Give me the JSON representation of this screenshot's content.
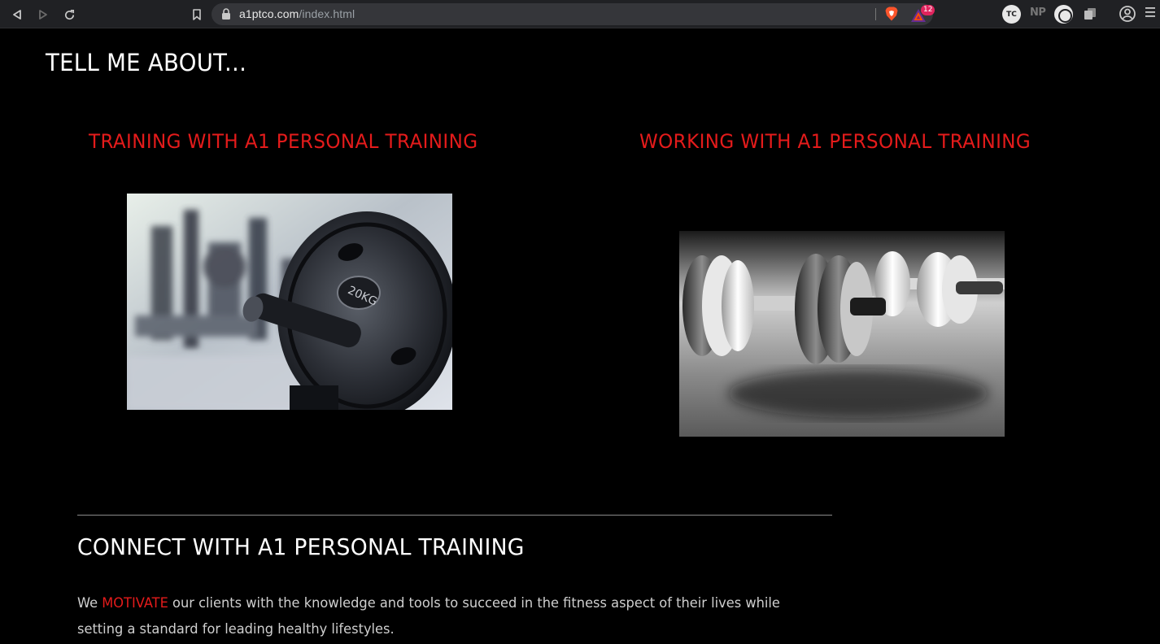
{
  "browser": {
    "url_host": "a1ptco.com",
    "url_path": "/index.html",
    "badge_count": "12",
    "ext_tc_label": "TC",
    "ext_np_label": "NP",
    "icons": [
      "back-icon",
      "forward-icon",
      "reload-icon",
      "bookmark-icon",
      "lock-icon",
      "brave-shield-icon",
      "brave-rewards-icon",
      "profile-icon",
      "menu-icon"
    ]
  },
  "page": {
    "heading": "TELL ME ABOUT...",
    "columns": [
      {
        "title": "TRAINING WITH A1 PERSONAL TRAINING",
        "image": "gym weight plate photo"
      },
      {
        "title": "WORKING WITH A1 PERSONAL TRAINING",
        "image": "dumbbells photo"
      }
    ],
    "connect": {
      "title": "CONNECT WITH A1 PERSONAL TRAINING",
      "text_before": "We ",
      "accent": "MOTIVATE",
      "text_after": " our clients with the knowledge and tools to succeed in the fitness aspect of their lives while setting a standard for leading healthy lifestyles."
    }
  },
  "colors": {
    "accent_red": "#e41b1b",
    "background": "#000000",
    "toolbar": "#202124"
  }
}
